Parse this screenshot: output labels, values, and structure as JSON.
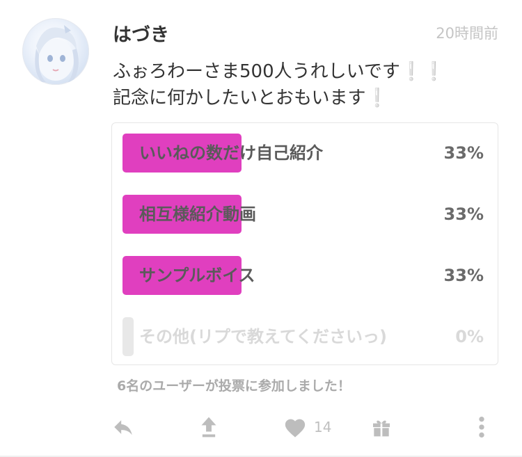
{
  "post": {
    "username": "はづき",
    "time": "20時間前",
    "text": "ふぉろわーさま500人うれしいです❕❕\n記念に何かしたいとおもいます❕"
  },
  "poll": {
    "options": [
      {
        "label": "いいねの数だけ自己紹介",
        "percent_text": "33%",
        "percent": 33
      },
      {
        "label": "相互様紹介動画",
        "percent_text": "33%",
        "percent": 33
      },
      {
        "label": "サンプルボイス",
        "percent_text": "33%",
        "percent": 33
      },
      {
        "label": "その他(リプで教えてくださいっ)",
        "percent_text": "0%",
        "percent": 0
      }
    ],
    "vote_summary": "6名のユーザーが投票に参加しました！",
    "accent_color": "#e03fbf"
  },
  "actions": {
    "like_count": "14",
    "icons": [
      "reply-icon",
      "repost-icon",
      "heart-icon",
      "gift-icon",
      "more-icon"
    ]
  }
}
